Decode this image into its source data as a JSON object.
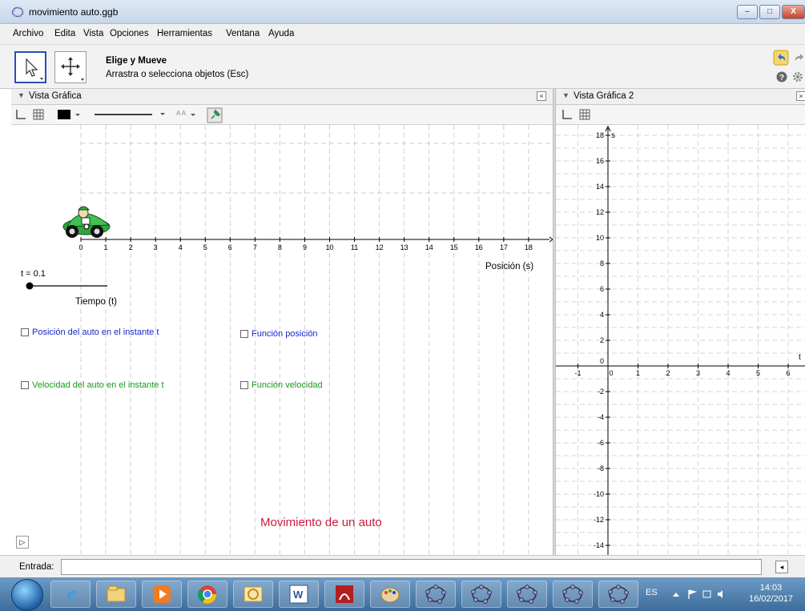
{
  "window": {
    "title": "movimiento auto.ggb",
    "buttons": {
      "minimize": "–",
      "maximize": "□",
      "close": "X"
    }
  },
  "menu": [
    "Archivo",
    "Edita",
    "Vista",
    "Opciones",
    "Herramientas",
    "Ventana",
    "Ayuda"
  ],
  "toolbar": {
    "tool_name": "Elige y Mueve",
    "tool_help": "Arrastra o selecciona objetos (Esc)"
  },
  "panels": {
    "graphics1": {
      "title": "Vista Gráfica",
      "close": "×"
    },
    "graphics2": {
      "title": "Vista Gráfica 2",
      "close": "×"
    }
  },
  "stylebar": {
    "font_size_label": "A A"
  },
  "graphics1": {
    "x_ticks": [
      0,
      1,
      2,
      3,
      4,
      5,
      6,
      7,
      8,
      9,
      10,
      11,
      12,
      13,
      14,
      15,
      16,
      17,
      18
    ],
    "x_axis_label": "Posición (s)",
    "t_value": "t = 0.1",
    "slider_label": "Tiempo (t)",
    "checkboxes": [
      {
        "label": "Posición del auto en el instante t"
      },
      {
        "label": "Función posición"
      },
      {
        "label": "Velocidad del auto en el instante t"
      },
      {
        "label": "Función velocidad"
      }
    ],
    "title": "Movimiento de un auto",
    "play": "▷"
  },
  "graphics2": {
    "x_ticks": [
      -1,
      0,
      1,
      2,
      3,
      4,
      5,
      6
    ],
    "y_ticks": [
      18,
      16,
      14,
      12,
      10,
      8,
      6,
      4,
      2,
      0,
      -2,
      -4,
      -6,
      -8,
      -10,
      -12,
      -14
    ],
    "y_axis_label": "s",
    "x_axis_label": "t"
  },
  "input_bar": {
    "label": "Entrada:",
    "value": "",
    "kbd": "◂"
  },
  "taskbar": {
    "lang": "ES",
    "time": "14:03",
    "date": "16/02/2017",
    "apps": [
      "internet-explorer",
      "file-explorer",
      "media-player",
      "chrome",
      "outlook",
      "word",
      "acrobat",
      "paint",
      "geogebra",
      "geogebra",
      "geogebra",
      "geogebra",
      "geogebra"
    ]
  },
  "colors": {
    "blue_checkbox": "#1428c8",
    "green_checkbox": "#1a9a1a",
    "title_red": "#d11a3a",
    "car_green": "#2ca83c"
  }
}
